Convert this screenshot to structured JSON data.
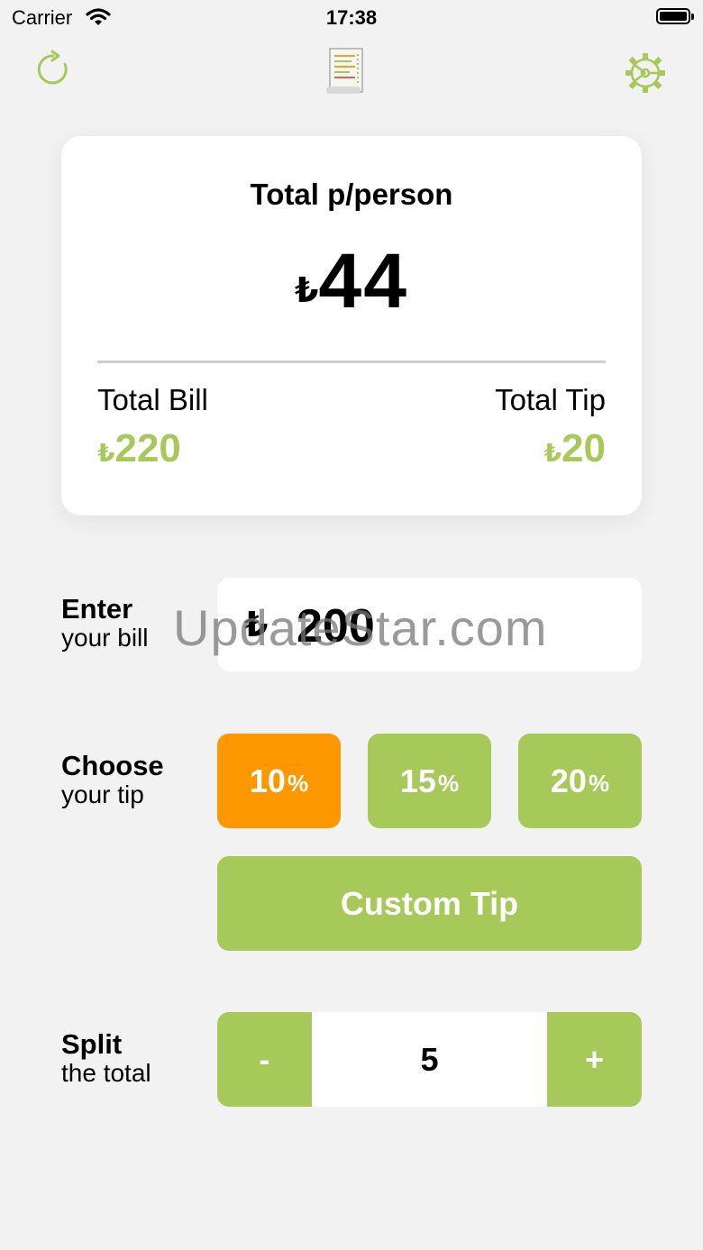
{
  "status_bar": {
    "carrier": "Carrier",
    "time": "17:38"
  },
  "nav": {
    "left_icon": "refresh-icon",
    "center_icon": "receipt-icon",
    "right_icon": "gear-icon"
  },
  "summary": {
    "title": "Total p/person",
    "currency": "₺",
    "per_person": "44",
    "total_bill_label": "Total Bill",
    "total_bill_value": "220",
    "total_tip_label": "Total Tip",
    "total_tip_value": "20"
  },
  "bill": {
    "label_bold": "Enter",
    "label_light": "your bill",
    "currency": "₺",
    "value": "200"
  },
  "tip": {
    "label_bold": "Choose",
    "label_light": "your tip",
    "options": [
      {
        "value": "10",
        "suffix": "%",
        "selected": true
      },
      {
        "value": "15",
        "suffix": "%",
        "selected": false
      },
      {
        "value": "20",
        "suffix": "%",
        "selected": false
      }
    ],
    "custom_label": "Custom Tip"
  },
  "split": {
    "label_bold": "Split",
    "label_light": "the total",
    "minus": "-",
    "plus": "+",
    "value": "5"
  },
  "watermark": "UpdateStar.com",
  "colors": {
    "accent_green": "#a6c95a",
    "selected_orange": "#fd9800",
    "background": "#f3f2f3"
  }
}
